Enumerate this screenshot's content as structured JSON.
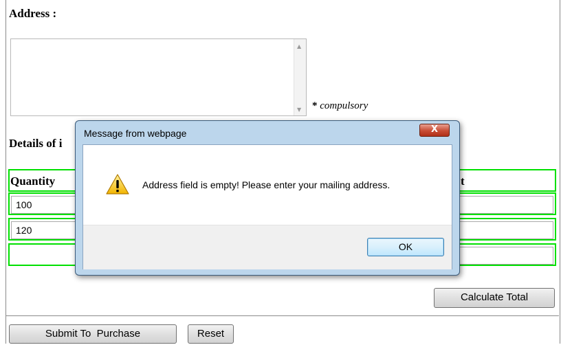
{
  "form": {
    "address_label": "Address :",
    "address_value": "",
    "compulsory_mark": "*",
    "compulsory_text": "compulsory",
    "details_label_visible": "Details of i",
    "table": {
      "header_first": "Quantity",
      "header_last_fragment": "t",
      "rows": [
        {
          "quantity": "100"
        },
        {
          "quantity": "120"
        },
        {
          "quantity": ""
        }
      ]
    },
    "calculate_label": "Calculate Total",
    "submit_label": "Submit To  Purchase",
    "reset_label": "Reset"
  },
  "dialog": {
    "title": "Message from webpage",
    "close_glyph": "X",
    "icon": "warning-icon",
    "message": "Address field is empty! Please enter your mailing address.",
    "ok_label": "OK"
  },
  "colors": {
    "table_border": "#00e000",
    "dialog_frame": "#bcd6ec",
    "close_button": "#c84c34",
    "ok_button_border": "#3c7fb1"
  }
}
